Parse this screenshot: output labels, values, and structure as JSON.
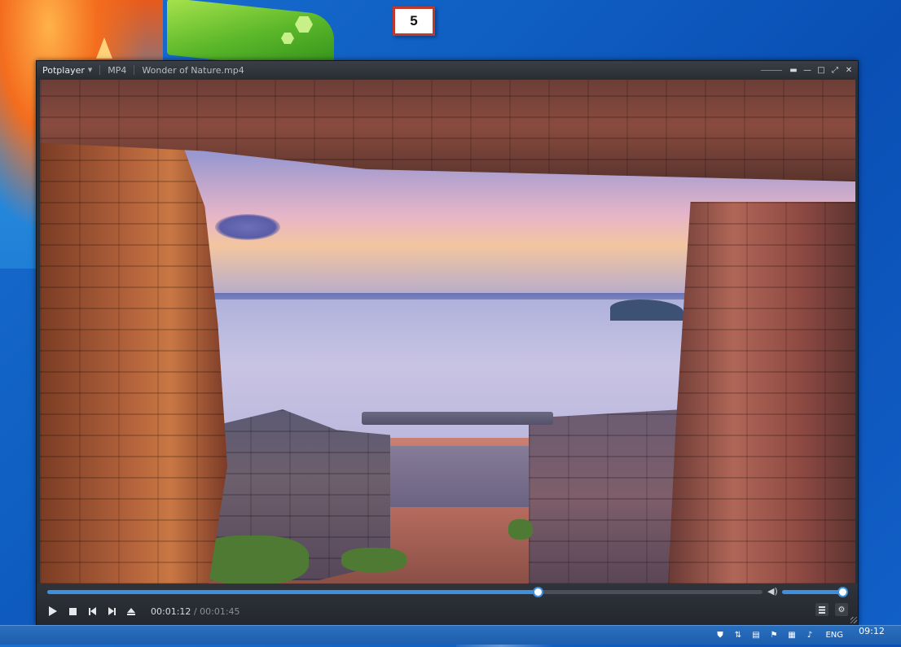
{
  "step_badge": "5",
  "player": {
    "brand": "Potplayer",
    "format": "MP4",
    "filename": "Wonder of Nature.mp4",
    "window_buttons": [
      "pin-icon",
      "minimize-icon",
      "maximize-icon",
      "fullscreen-icon",
      "close-icon"
    ],
    "playback": {
      "current_time": "00:01:12",
      "separator": "/",
      "total_time": "00:01:45",
      "progress_fraction": 0.686,
      "volume_fraction": 0.98
    },
    "accent_color": "#3d8fe0"
  },
  "taskbar": {
    "language": "ENG",
    "clock": "09:12"
  }
}
